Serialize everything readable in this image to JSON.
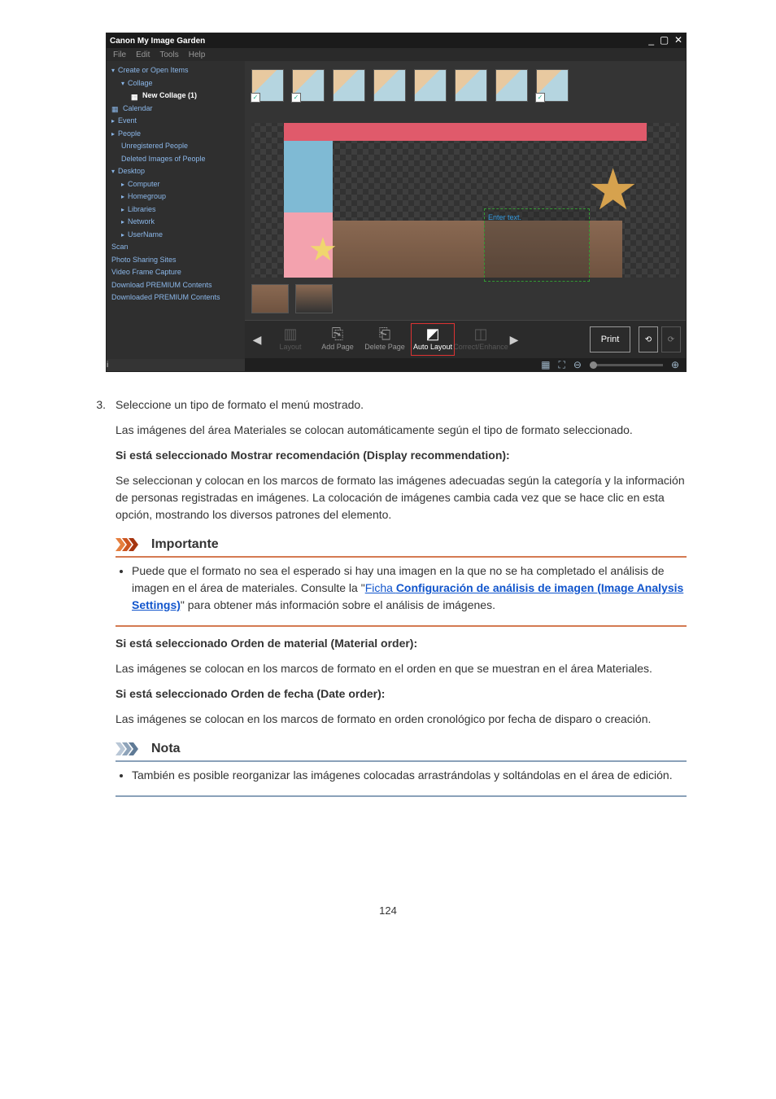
{
  "app": {
    "title": "Canon My Image Garden",
    "menus": [
      "File",
      "Edit",
      "Tools",
      "Help"
    ],
    "sidebar": [
      {
        "label": "Create or Open Items",
        "level": 0,
        "expand": "open"
      },
      {
        "label": "Collage",
        "level": 1,
        "expand": "open"
      },
      {
        "label": "New Collage (1)",
        "level": 2,
        "selected": true
      },
      {
        "label": "Calendar",
        "level": 0
      },
      {
        "label": "Event",
        "level": 0,
        "expand": "closed"
      },
      {
        "label": "People",
        "level": 0,
        "expand": "closed"
      },
      {
        "label": "Unregistered People",
        "level": 1
      },
      {
        "label": "Deleted Images of People",
        "level": 1
      },
      {
        "label": "Desktop",
        "level": 0,
        "expand": "open"
      },
      {
        "label": "Computer",
        "level": 1,
        "expand": "closed"
      },
      {
        "label": "Homegroup",
        "level": 1,
        "expand": "closed"
      },
      {
        "label": "Libraries",
        "level": 1,
        "expand": "closed"
      },
      {
        "label": "Network",
        "level": 1,
        "expand": "closed"
      },
      {
        "label": "UserName",
        "level": 1,
        "expand": "closed"
      },
      {
        "label": "Scan",
        "level": 0
      },
      {
        "label": "Photo Sharing Sites",
        "level": 0
      },
      {
        "label": "Video Frame Capture",
        "level": 0
      },
      {
        "label": "Download PREMIUM Contents",
        "level": 0
      },
      {
        "label": "Downloaded PREMIUM Contents",
        "level": 0
      }
    ],
    "info_glyph": "i",
    "enter_text": "Enter text.",
    "bottom_buttons": {
      "layout": "Layout",
      "add_page": "Add Page",
      "delete_page": "Delete Page",
      "auto_layout": "Auto Layout",
      "correct_enhance": "Correct/Enhance",
      "print": "Print"
    }
  },
  "doc": {
    "step3_num": "3.",
    "step3_title": "Seleccione un tipo de formato el menú mostrado.",
    "step3_p1": "Las imágenes del área Materiales se colocan automáticamente según el tipo de formato seleccionado.",
    "h_display": "Si está seleccionado Mostrar recomendación (Display recommendation):",
    "p_display": "Se seleccionan y colocan en los marcos de formato las imágenes adecuadas según la categoría y la información de personas registradas en imágenes. La colocación de imágenes cambia cada vez que se hace clic en esta opción, mostrando los diversos patrones del elemento.",
    "importante_heading": "Importante",
    "imp_before_link": "Puede que el formato no sea el esperado si hay una imagen en la que no se ha completado el análisis de imagen en el área de materiales. Consulte la \"",
    "imp_link_pre": "Ficha ",
    "imp_link_bold": "Configuración de análisis de imagen (Image Analysis Settings)",
    "imp_after_link": "\" para obtener más información sobre el análisis de imágenes.",
    "h_material": "Si está seleccionado Orden de material (Material order):",
    "p_material": "Las imágenes se colocan en los marcos de formato en el orden en que se muestran en el área Materiales.",
    "h_date": "Si está seleccionado Orden de fecha (Date order):",
    "p_date": "Las imágenes se colocan en los marcos de formato en orden cronológico por fecha de disparo o creación.",
    "nota_heading": "Nota",
    "nota_bullet": "También es posible reorganizar las imágenes colocadas arrastrándolas y soltándolas en el área de edición.",
    "page_number": "124"
  },
  "colors": {
    "important_accent": "#d47a52",
    "note_accent": "#8aa1b9",
    "link": "#1155cc"
  }
}
